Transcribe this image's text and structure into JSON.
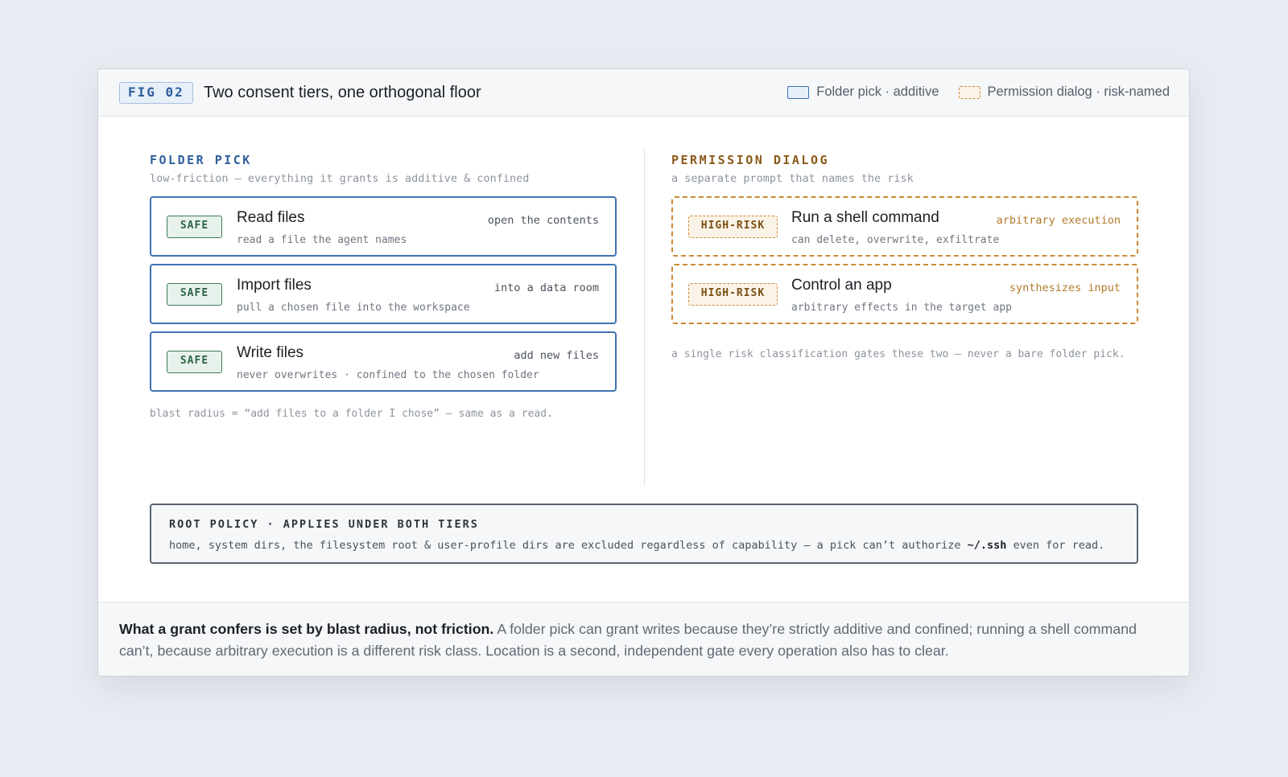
{
  "header": {
    "fig_label": "FIG 02",
    "title": "Two consent tiers, one orthogonal floor",
    "legend": {
      "folder": "Folder pick · additive",
      "permission": "Permission dialog · risk-named"
    }
  },
  "left": {
    "heading": "FOLDER PICK",
    "subheading": "low-friction — everything it grants is additive & confined",
    "rows": [
      {
        "badge": "SAFE",
        "title": "Read files",
        "note": "open the contents",
        "desc": "read a file the agent names"
      },
      {
        "badge": "SAFE",
        "title": "Import files",
        "note": "into a data room",
        "desc": "pull a chosen file into the workspace"
      },
      {
        "badge": "SAFE",
        "title": "Write files",
        "note": "add new files",
        "desc": "never overwrites · confined to the chosen folder"
      }
    ],
    "footnote": "blast radius = “add files to a folder I chose” — same as a read."
  },
  "right": {
    "heading": "PERMISSION DIALOG",
    "subheading": "a separate prompt that names the risk",
    "rows": [
      {
        "badge": "HIGH-RISK",
        "title": "Run a shell command",
        "note": "arbitrary execution",
        "desc": "can delete, overwrite, exfiltrate"
      },
      {
        "badge": "HIGH-RISK",
        "title": "Control an app",
        "note": "synthesizes input",
        "desc": "arbitrary effects in the target app"
      }
    ],
    "footnote": "a single risk classification gates these two — never a bare folder pick."
  },
  "policy": {
    "heading": "ROOT POLICY · APPLIES UNDER BOTH TIERS",
    "body_before": "home, system dirs, the filesystem root & user-profile dirs are excluded regardless of capability — a pick can’t authorize ",
    "body_code": "~/.ssh",
    "body_after": " even for read."
  },
  "caption": {
    "bold": "What a grant confers is set by blast radius, not friction.",
    "rest": " A folder pick can grant writes because they’re strictly additive and confined; running a shell command can’t, because arbitrary execution is a different risk class. Location is a second, independent gate every operation also has to clear."
  }
}
